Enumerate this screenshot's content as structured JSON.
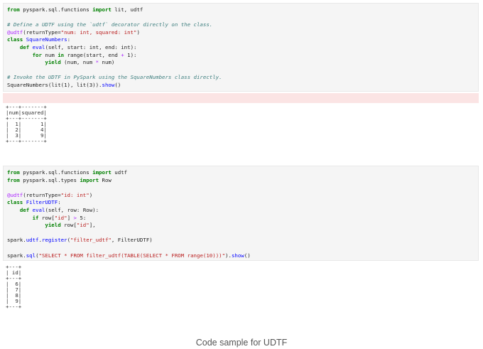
{
  "cell1": {
    "lines": [
      [
        [
          "kw",
          "from"
        ],
        [
          "",
          " pyspark.sql.functions "
        ],
        [
          "kw",
          "import"
        ],
        [
          "",
          " lit, udtf"
        ]
      ],
      [],
      [
        [
          "cm",
          "# Define a UDTF using the `udtf` decorator directly on the class."
        ]
      ],
      [
        [
          "dec",
          "@udtf"
        ],
        [
          "",
          "(returnType="
        ],
        [
          "st",
          "\"num: int, squared: int\""
        ],
        [
          "",
          ")"
        ]
      ],
      [
        [
          "kw",
          "class"
        ],
        [
          "",
          " "
        ],
        [
          "fn",
          "SquareNumbers"
        ],
        [
          "",
          ":"
        ]
      ],
      [
        [
          "",
          "    "
        ],
        [
          "kw",
          "def"
        ],
        [
          "",
          " "
        ],
        [
          "fn",
          "eval"
        ],
        [
          "",
          "(self, start: int, end: int):"
        ]
      ],
      [
        [
          "",
          "        "
        ],
        [
          "kw",
          "for"
        ],
        [
          "",
          " num "
        ],
        [
          "kw",
          "in"
        ],
        [
          "",
          " range(start, end "
        ],
        [
          "op",
          "+"
        ],
        [
          "",
          " 1):"
        ]
      ],
      [
        [
          "",
          "            "
        ],
        [
          "kw",
          "yield"
        ],
        [
          "",
          " (num, num "
        ],
        [
          "op",
          "*"
        ],
        [
          "",
          " num)"
        ]
      ],
      [],
      [
        [
          "cm",
          "# Invoke the UDTF in PySpark using the SquareNumbers class directly."
        ]
      ],
      [
        [
          "",
          "SquareNumbers(lit(1), lit(3))."
        ],
        [
          "fn",
          "show"
        ],
        [
          "",
          "()"
        ]
      ]
    ]
  },
  "output1": {
    "lines": [
      "+---+-------+",
      "|num|squared|",
      "+---+-------+",
      "|  1|      1|",
      "|  2|      4|",
      "|  3|      9|",
      "+---+-------+"
    ]
  },
  "cell2": {
    "lines": [
      [
        [
          "kw",
          "from"
        ],
        [
          "",
          " pyspark.sql.functions "
        ],
        [
          "kw",
          "import"
        ],
        [
          "",
          " udtf"
        ]
      ],
      [
        [
          "kw",
          "from"
        ],
        [
          "",
          " pyspark.sql.types "
        ],
        [
          "kw",
          "import"
        ],
        [
          "",
          " Row"
        ]
      ],
      [],
      [
        [
          "dec",
          "@udtf"
        ],
        [
          "",
          "(returnType="
        ],
        [
          "st",
          "\"id: int\""
        ],
        [
          "",
          ")"
        ]
      ],
      [
        [
          "kw",
          "class"
        ],
        [
          "",
          " "
        ],
        [
          "fn",
          "FilterUDTF"
        ],
        [
          "",
          ":"
        ]
      ],
      [
        [
          "",
          "    "
        ],
        [
          "kw",
          "def"
        ],
        [
          "",
          " "
        ],
        [
          "fn",
          "eval"
        ],
        [
          "",
          "(self, row: Row):"
        ]
      ],
      [
        [
          "",
          "        "
        ],
        [
          "kw",
          "if"
        ],
        [
          "",
          " row["
        ],
        [
          "st",
          "\"id\""
        ],
        [
          "",
          "] "
        ],
        [
          "op",
          ">"
        ],
        [
          "",
          " 5:"
        ]
      ],
      [
        [
          "",
          "            "
        ],
        [
          "kw",
          "yield"
        ],
        [
          "",
          " row["
        ],
        [
          "st",
          "\"id\""
        ],
        [
          "",
          "],"
        ]
      ],
      [],
      [
        [
          "",
          "spark."
        ],
        [
          "fn",
          "udtf"
        ],
        [
          "",
          "."
        ],
        [
          "fn",
          "register"
        ],
        [
          "",
          "("
        ],
        [
          "st",
          "\"filter_udtf\""
        ],
        [
          "",
          ", FilterUDTF)"
        ]
      ],
      [],
      [
        [
          "",
          "spark."
        ],
        [
          "fn",
          "sql"
        ],
        [
          "",
          "("
        ],
        [
          "st",
          "\"SELECT * FROM filter_udtf(TABLE(SELECT * FROM range(10)))\""
        ],
        [
          "",
          ")."
        ],
        [
          "fn",
          "show"
        ],
        [
          "",
          "()"
        ]
      ]
    ]
  },
  "output2": {
    "lines": [
      "+---+",
      "| id|",
      "+---+",
      "|  6|",
      "|  7|",
      "|  8|",
      "|  9|",
      "+---+"
    ]
  },
  "caption": "Code sample for UDTF"
}
